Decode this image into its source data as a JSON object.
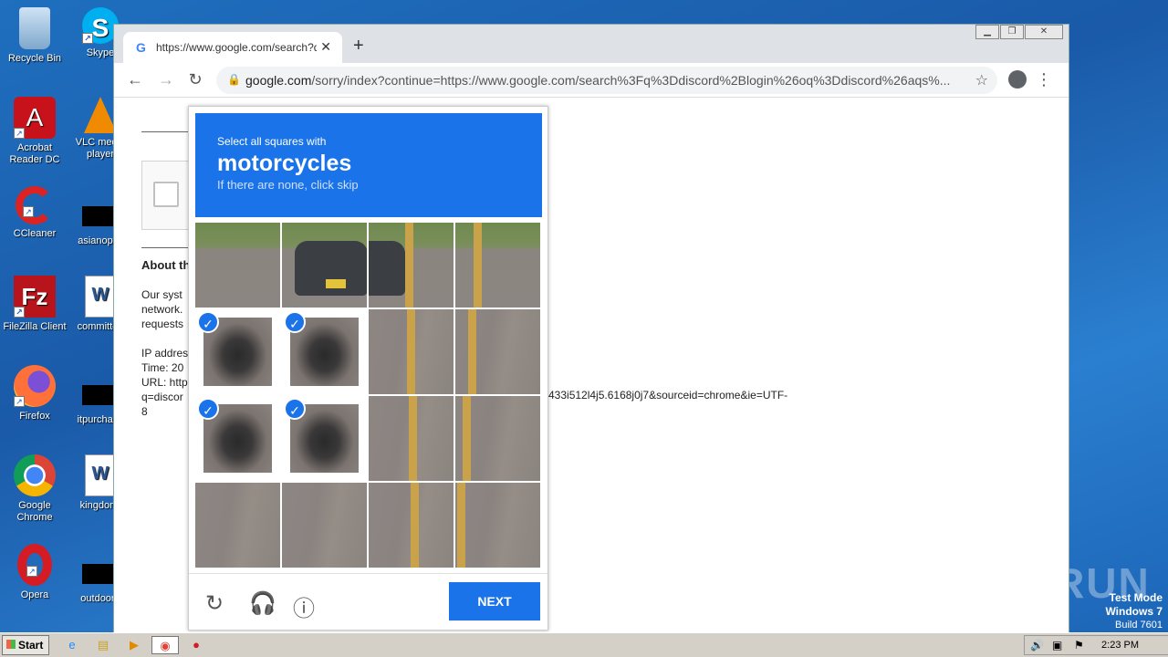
{
  "desktop": {
    "icons": [
      {
        "label": "Recycle Bin",
        "line2": "",
        "glyph": "recycle-bin-icon"
      },
      {
        "label": "Skype",
        "line2": "",
        "glyph": "skype-icon"
      },
      {
        "label": "Acrobat",
        "line2": "Reader DC",
        "glyph": "acrobat-icon"
      },
      {
        "label": "VLC media",
        "line2": "player",
        "glyph": "vlc-icon"
      },
      {
        "label": "CCleaner",
        "line2": "",
        "glyph": "ccleaner-icon"
      },
      {
        "label": "asianoptic",
        "line2": "",
        "glyph": "file-icon"
      },
      {
        "label": "FileZilla Client",
        "line2": "",
        "glyph": "filezilla-icon"
      },
      {
        "label": "committee",
        "line2": "",
        "glyph": "word-doc-icon"
      },
      {
        "label": "Firefox",
        "line2": "",
        "glyph": "firefox-icon"
      },
      {
        "label": "itpurchase",
        "line2": "",
        "glyph": "file-icon"
      },
      {
        "label": "Google",
        "line2": "Chrome",
        "glyph": "chrome-icon"
      },
      {
        "label": "kingdomf",
        "line2": "",
        "glyph": "word-doc-icon"
      },
      {
        "label": "Opera",
        "line2": "",
        "glyph": "opera-icon"
      },
      {
        "label": "outdoorg",
        "line2": "",
        "glyph": "file-icon"
      }
    ],
    "watermark": "ANY RUN",
    "test_mode": {
      "line1": "Test Mode",
      "line2": "Windows 7",
      "line3": "Build 7601"
    }
  },
  "browser": {
    "tab_title": "https://www.google.com/search?q=",
    "tab_favicon": "G",
    "address_domain": "google.com",
    "address_rest": "/sorry/index?continue=https://www.google.com/search%3Fq%3Ddiscord%2Blogin%26oq%3Ddiscord%26aqs%...",
    "page": {
      "about_heading": "About th",
      "para1_l1": "Our syst",
      "para1_l2": "network.",
      "para1_l3": "requests",
      "ip_label": "IP addres",
      "time_label": "Time: 20",
      "url_label": "URL: http",
      "url_q": "q=discor",
      "url_8": "8",
      "url_tail": "433i512l4j5.6168j0j7&sourceid=chrome&ie=UTF-"
    }
  },
  "recaptcha": {
    "instruction": "Select all squares with",
    "target": "motorcycles",
    "hint": "If there are none, click skip",
    "next_label": "NEXT",
    "selected_tiles": [
      4,
      5,
      8,
      9
    ],
    "colors": {
      "accent": "#1a73e8"
    }
  },
  "taskbar": {
    "start_label": "Start",
    "clock": "2:23 PM"
  }
}
